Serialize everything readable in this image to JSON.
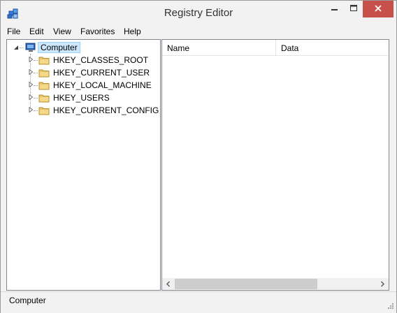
{
  "window": {
    "title": "Registry Editor",
    "close_color": "#c7504a"
  },
  "menu": [
    "File",
    "Edit",
    "View",
    "Favorites",
    "Help"
  ],
  "tree": {
    "root": {
      "label": "Computer",
      "icon": "computer-icon",
      "expanded": true,
      "selected": true
    },
    "children": [
      {
        "label": "HKEY_CLASSES_ROOT",
        "icon": "folder-icon"
      },
      {
        "label": "HKEY_CURRENT_USER",
        "icon": "folder-icon"
      },
      {
        "label": "HKEY_LOCAL_MACHINE",
        "icon": "folder-icon"
      },
      {
        "label": "HKEY_USERS",
        "icon": "folder-icon"
      },
      {
        "label": "HKEY_CURRENT_CONFIG",
        "icon": "folder-icon"
      }
    ]
  },
  "list": {
    "columns": [
      "Name",
      "Data"
    ]
  },
  "status": {
    "path": "Computer"
  }
}
